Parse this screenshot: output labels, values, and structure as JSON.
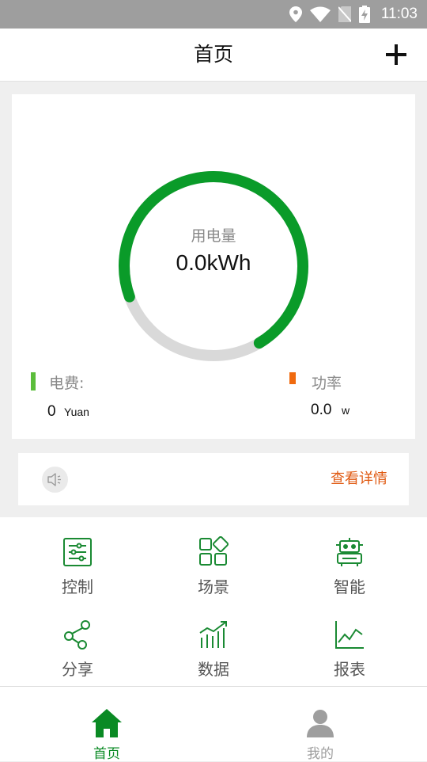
{
  "status_bar": {
    "time": "11:03"
  },
  "header": {
    "title": "首页"
  },
  "usage": {
    "label": "用电量",
    "value": "0.0kWh",
    "progress_fraction": 0.72,
    "progress_color": "#0a9b29",
    "track_color": "#d9d9d9"
  },
  "cost": {
    "label": "电费:",
    "value": "0",
    "unit": "Yuan",
    "indicator_color": "#5bbd3b"
  },
  "power": {
    "label": "功率",
    "value": "0.0",
    "unit": "w",
    "indicator_color": "#f06a0f"
  },
  "notice": {
    "icon": "speaker-icon",
    "link_label": "查看详情"
  },
  "functions": [
    {
      "id": "control",
      "label": "控制",
      "icon": "sliders-icon"
    },
    {
      "id": "scene",
      "label": "场景",
      "icon": "scene-grid-icon"
    },
    {
      "id": "smart",
      "label": "智能",
      "icon": "robot-icon"
    },
    {
      "id": "share",
      "label": "分享",
      "icon": "share-icon"
    },
    {
      "id": "data",
      "label": "数据",
      "icon": "bar-trend-icon"
    },
    {
      "id": "report",
      "label": "报表",
      "icon": "line-chart-icon"
    }
  ],
  "bottom_nav": [
    {
      "label": "首页",
      "icon": "home-icon",
      "active": true,
      "color": "#0a8a24"
    },
    {
      "label": "我的",
      "icon": "user-icon",
      "active": false,
      "color": "#9e9e9e"
    }
  ],
  "theme": {
    "accent": "#0a9b29",
    "icon_green": "#1a8a33"
  }
}
